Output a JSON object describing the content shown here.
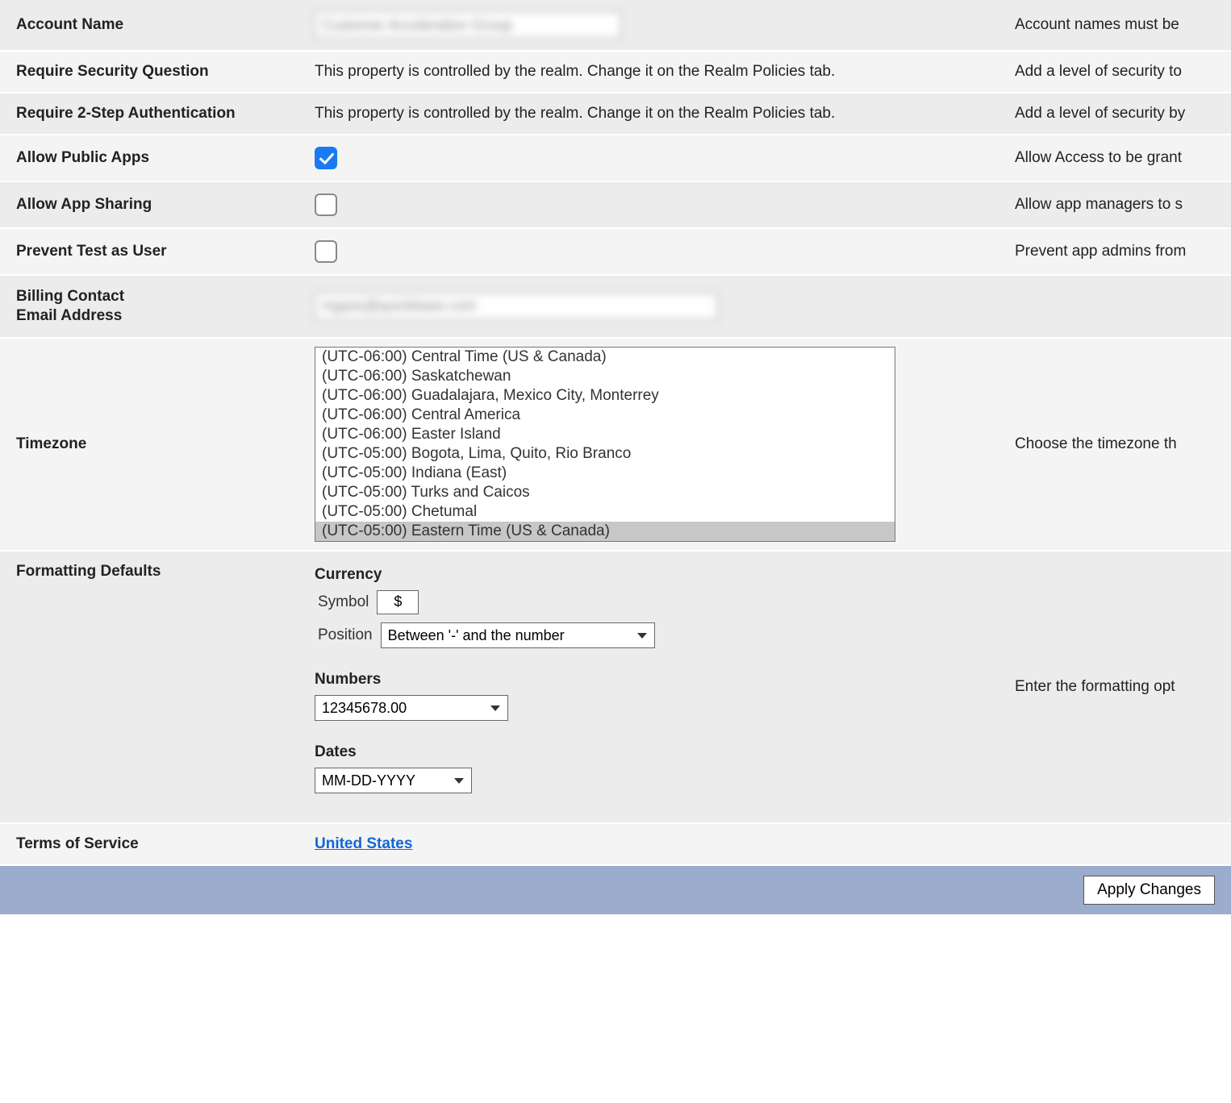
{
  "rows": {
    "accountName": {
      "label": "Account Name",
      "value": "Customer Acceleration Group",
      "desc": "Account names must be"
    },
    "requireSecQ": {
      "label": "Require Security Question",
      "text": "This property is controlled by the realm. Change it on the Realm Policies tab.",
      "desc": "Add a level of security to"
    },
    "require2fa": {
      "label": "Require 2-Step Authentication",
      "text": "This property is controlled by the realm. Change it on the Realm Policies tab.",
      "desc": "Add a level of security by"
    },
    "allowPublic": {
      "label": "Allow Public Apps",
      "checked": true,
      "desc": "Allow Access to be grant"
    },
    "allowSharing": {
      "label": "Allow App Sharing",
      "checked": false,
      "desc": "Allow app managers to s"
    },
    "preventTest": {
      "label": "Prevent Test as User",
      "checked": false,
      "desc": "Prevent app admins from"
    },
    "billing": {
      "label": "Billing Contact\nEmail Address",
      "value": "mgass@quickbase.com",
      "desc": ""
    },
    "timezone": {
      "label": "Timezone",
      "desc": "Choose the timezone th",
      "options": [
        "(UTC-06:00) Central Time (US & Canada)",
        "(UTC-06:00) Saskatchewan",
        "(UTC-06:00) Guadalajara, Mexico City, Monterrey",
        "(UTC-06:00) Central America",
        "(UTC-06:00) Easter Island",
        "(UTC-05:00) Bogota, Lima, Quito, Rio Branco",
        "(UTC-05:00) Indiana (East)",
        "(UTC-05:00) Turks and Caicos",
        "(UTC-05:00) Chetumal",
        "(UTC-05:00) Eastern Time (US & Canada)"
      ],
      "selectedIndex": 9
    },
    "formatting": {
      "label": "Formatting Defaults",
      "desc": "Enter the formatting opt",
      "currencyHeading": "Currency",
      "symbolLabel": "Symbol",
      "symbolValue": "$",
      "positionLabel": "Position",
      "positionValue": "Between '-' and the number",
      "numbersHeading": "Numbers",
      "numbersValue": "12345678.00",
      "datesHeading": "Dates",
      "datesValue": "MM-DD-YYYY"
    },
    "tos": {
      "label": "Terms of Service",
      "link": "United States",
      "desc": ""
    }
  },
  "actions": {
    "apply": "Apply Changes"
  }
}
